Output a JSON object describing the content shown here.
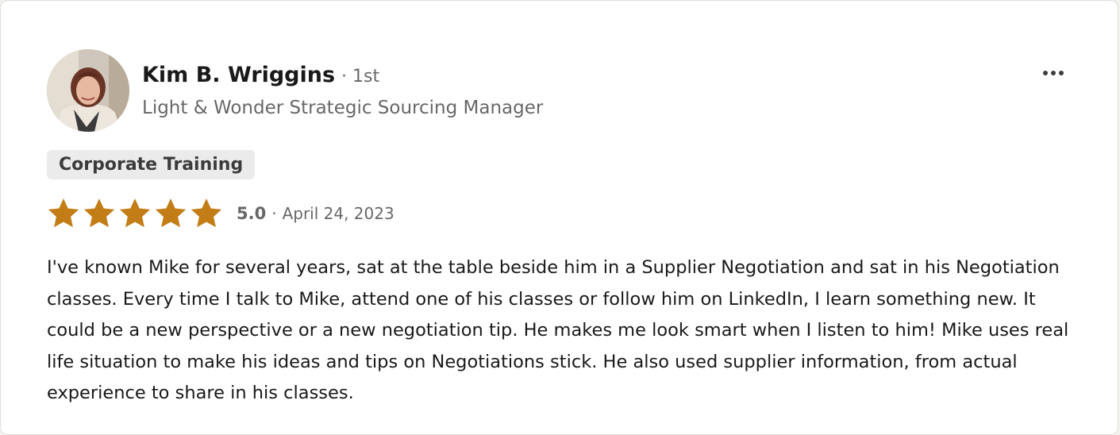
{
  "reviewer": {
    "name": "Kim B. Wriggins",
    "degree": "· 1st",
    "headline": "Light & Wonder Strategic Sourcing Manager",
    "avatar_icon": "profile-photo"
  },
  "more_button_icon": "ellipsis-icon",
  "service": {
    "label": "Corporate Training"
  },
  "rating": {
    "stars": 5,
    "max_stars": 5,
    "score": "5.0",
    "separator": "·",
    "date": "April 24, 2023",
    "star_color": "#c37d16"
  },
  "review": {
    "text": "I've known Mike for several years, sat at the table beside him in a Supplier Negotiation and sat in his Negotiation classes. Every time I talk to Mike, attend one of his classes or follow him on LinkedIn, I learn something new. It could be a new perspective or a new negotiation tip. He makes me look smart when I listen to him! Mike uses real life situation to make his ideas and tips on Negotiations stick. He also used supplier information, from actual experience to share in his classes."
  }
}
